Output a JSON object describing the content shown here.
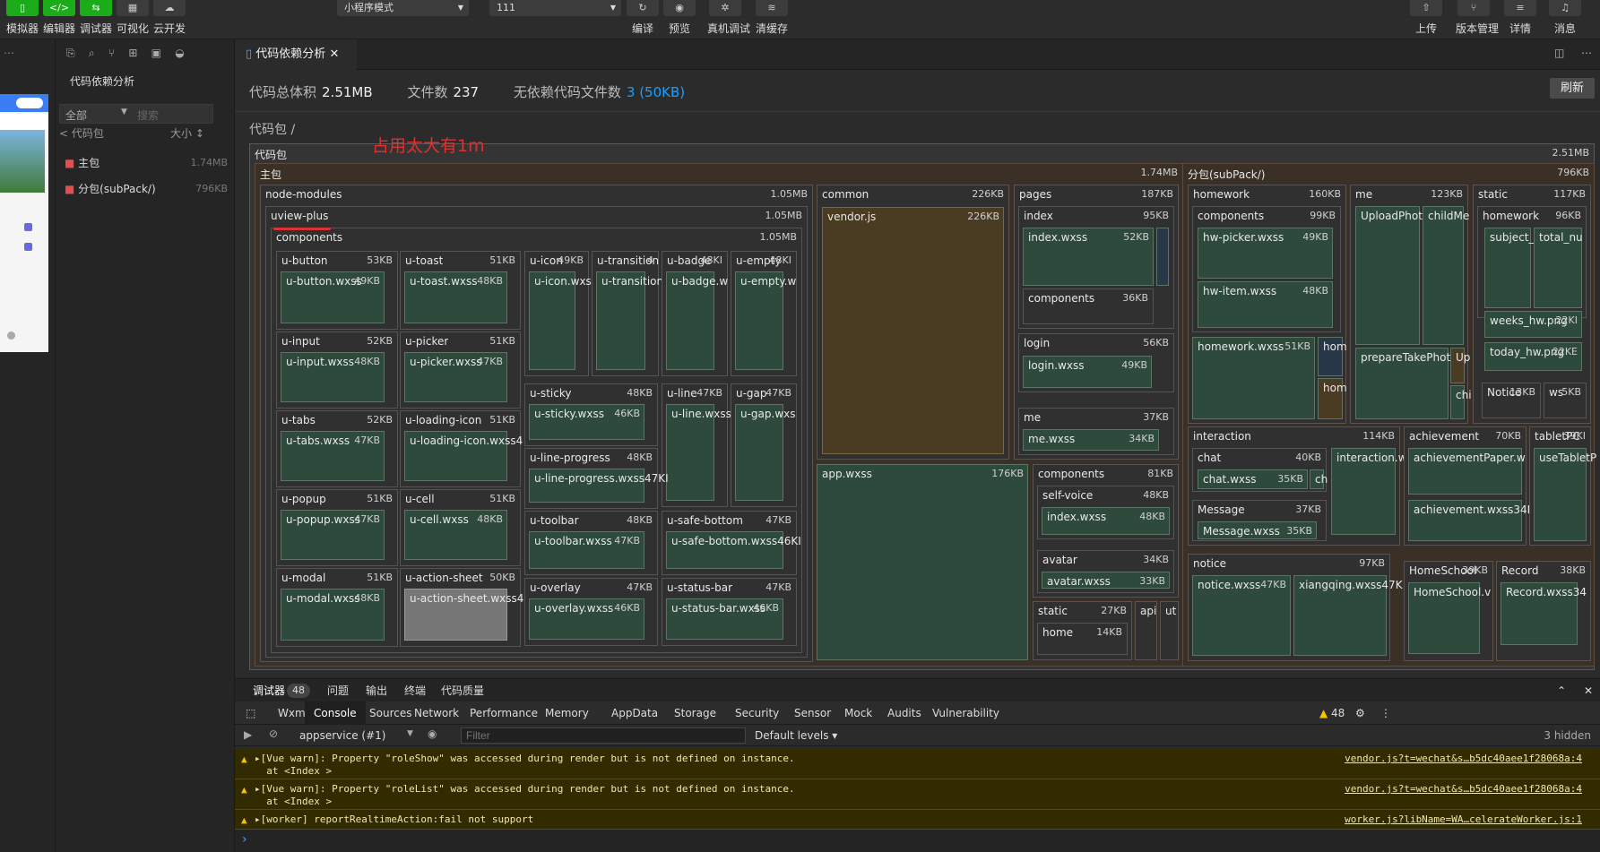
{
  "toolbar": {
    "left_buttons": [
      {
        "label": "模拟器",
        "icon": "phone-icon"
      },
      {
        "label": "编辑器",
        "icon": "code-icon"
      },
      {
        "label": "调试器",
        "icon": "debug-icon"
      },
      {
        "label": "可视化",
        "icon": "layout-icon"
      },
      {
        "label": "云开发",
        "icon": "cloud-icon"
      }
    ],
    "mode_select": "小程序模式",
    "compile_select": "111",
    "center_buttons": [
      {
        "label": "编译",
        "icon": "refresh-icon"
      },
      {
        "label": "预览",
        "icon": "eye-icon"
      },
      {
        "label": "真机调试",
        "icon": "bug-icon"
      },
      {
        "label": "清缓存",
        "icon": "layers-icon"
      }
    ],
    "right_buttons": [
      {
        "label": "上传",
        "icon": "upload-icon"
      },
      {
        "label": "版本管理",
        "icon": "branch-icon"
      },
      {
        "label": "详情",
        "icon": "menu-icon"
      },
      {
        "label": "消息",
        "icon": "bell-icon"
      }
    ]
  },
  "sidebar": {
    "title": "代码依赖分析",
    "filter": "全部",
    "search_placeholder": "搜索",
    "back": "< 代码包",
    "sort": "大小 ↕",
    "items": [
      {
        "label": "主包",
        "size": "1.74MB"
      },
      {
        "label": "分包(subPack/)",
        "size": "796KB"
      }
    ]
  },
  "tab": {
    "title": "代码依赖分析",
    "close": "✕"
  },
  "stats": {
    "total_label": "代码总体积",
    "total": "2.51MB",
    "files_label": "文件数",
    "files": "237",
    "nodep_label": "无依赖代码文件数",
    "nodep": "3 (50KB)",
    "refresh": "刷新"
  },
  "crumb": "代码包 /",
  "annotation": "占用太大有1m",
  "treemap": {
    "root": {
      "label": "代码包",
      "size": "2.51MB"
    },
    "main": {
      "label": "主包",
      "size": "1.74MB"
    },
    "subpack": {
      "label": "分包(subPack/)",
      "size": "796KB"
    },
    "node_modules": {
      "label": "node-modules",
      "size": "1.05MB"
    },
    "uview": {
      "label": "uview-plus",
      "size": "1.05MB"
    },
    "components": {
      "label": "components",
      "size": "1.05MB"
    },
    "comps": [
      {
        "label": "u-button",
        "size": "53KB",
        "file": "u-button.wxss",
        "fsize": "49KB"
      },
      {
        "label": "u-toast",
        "size": "51KB",
        "file": "u-toast.wxss",
        "fsize": "48KB"
      },
      {
        "label": "u-icon",
        "size": "49KB",
        "file": "u-icon.wxss",
        "fsize": ""
      },
      {
        "label": "u-transition",
        "size": "4",
        "file": "u-transition",
        "fsize": ""
      },
      {
        "label": "u-badge",
        "size": "48KI",
        "file": "u-badge.w",
        "fsize": ""
      },
      {
        "label": "u-empty",
        "size": "48KI",
        "file": "u-empty.w",
        "fsize": ""
      },
      {
        "label": "u-input",
        "size": "52KB",
        "file": "u-input.wxss",
        "fsize": "48KB"
      },
      {
        "label": "u-picker",
        "size": "51KB",
        "file": "u-picker.wxss",
        "fsize": "47KB"
      },
      {
        "label": "u-sticky",
        "size": "48KB",
        "file": "u-sticky.wxss",
        "fsize": "46KB"
      },
      {
        "label": "u-line",
        "size": "47KB",
        "file": "u-line.wxss",
        "fsize": ""
      },
      {
        "label": "u-gap",
        "size": "47KB",
        "file": "u-gap.wxs",
        "fsize": ""
      },
      {
        "label": "u-tabs",
        "size": "52KB",
        "file": "u-tabs.wxss",
        "fsize": "47KB"
      },
      {
        "label": "u-loading-icon",
        "size": "51KB",
        "file": "u-loading-icon.wxss4",
        "fsize": ""
      },
      {
        "label": "u-line-progress",
        "size": "48KB",
        "file": "u-line-progress.wxss47KI",
        "fsize": ""
      },
      {
        "label": "u-popup",
        "size": "51KB",
        "file": "u-popup.wxss",
        "fsize": "47KB"
      },
      {
        "label": "u-cell",
        "size": "51KB",
        "file": "u-cell.wxss",
        "fsize": "48KB"
      },
      {
        "label": "u-toolbar",
        "size": "48KB",
        "file": "u-toolbar.wxss",
        "fsize": "47KB"
      },
      {
        "label": "u-safe-bottom",
        "size": "47KB",
        "file": "u-safe-bottom.wxss46KI",
        "fsize": ""
      },
      {
        "label": "u-modal",
        "size": "51KB",
        "file": "u-modal.wxss",
        "fsize": "48KB"
      },
      {
        "label": "u-action-sheet",
        "size": "50KB",
        "file": "u-action-sheet.wxss4",
        "fsize": ""
      },
      {
        "label": "u-overlay",
        "size": "47KB",
        "file": "u-overlay.wxss",
        "fsize": "46KB"
      },
      {
        "label": "u-status-bar",
        "size": "47KB",
        "file": "u-status-bar.wxss",
        "fsize": "46KB"
      }
    ],
    "common": {
      "label": "common",
      "size": "226KB",
      "file": "vendor.js",
      "fsize": "226KB"
    },
    "app": {
      "label": "app.wxss",
      "size": "176KB"
    },
    "pages": {
      "label": "pages",
      "size": "187KB"
    },
    "index": {
      "label": "index",
      "size": "95KB",
      "file": "index.wxss",
      "fsize": "52KB",
      "sub": "components",
      "subsize": "36KB"
    },
    "login": {
      "label": "login",
      "size": "56KB",
      "file": "login.wxss",
      "fsize": "49KB"
    },
    "me": {
      "label": "me",
      "size": "37KB",
      "file": "me.wxss",
      "fsize": "34KB"
    },
    "rcomponents": {
      "label": "components",
      "size": "81KB",
      "a": "self-voice",
      "asize": "48KB",
      "afile": "index.wxss",
      "afsize": "48KB",
      "b": "avatar",
      "bsize": "34KB",
      "bfile": "avatar.wxss",
      "bfsize": "33KB"
    },
    "static": {
      "label": "static",
      "size": "27KB",
      "file": "home",
      "fsize": "14KB"
    },
    "api": {
      "label": "api"
    },
    "ut": {
      "label": "ut"
    },
    "homework": {
      "label": "homework",
      "size": "160KB",
      "c": "components",
      "csize": "99KB",
      "f1": "hw-picker.wxss",
      "f1s": "49KB",
      "f2": "hw-item.wxss",
      "f2s": "48KB",
      "f3": "homework.wxss",
      "f3s": "51KB",
      "f4": "hom",
      "f5": "hom"
    },
    "me2": {
      "label": "me",
      "size": "123KB",
      "f1": "UploadPhoto",
      "f2": "childMe",
      "f3": "prepareTakePhoto",
      "f4": "Up",
      "f5": "chi"
    },
    "static2": {
      "label": "static",
      "size": "117KB",
      "h": "homework",
      "hsize": "96KB",
      "f1": "subject_l",
      "f2": "total_nu",
      "f3": "weeks_hw.png",
      "f3s": "22KI",
      "f4": "today_hw.png",
      "f4s": "22KE",
      "f5": "Notice",
      "f5s": "13KB",
      "f6": "ws",
      "f6s": "5KB"
    },
    "interaction": {
      "label": "interaction",
      "size": "114KB",
      "chat": "chat",
      "chatsize": "40KB",
      "chatfile": "chat.wxss",
      "chatfs": "35KB",
      "chatx": "ch",
      "ifile": "interaction.w",
      "msg": "Message",
      "msgsize": "37KB",
      "msgfile": "Message.wxss",
      "msgfs": "35KB"
    },
    "achievement": {
      "label": "achievement",
      "size": "70KB",
      "f1": "achievementPaper.w",
      "f2": "achievement.wxss34I"
    },
    "tablet": {
      "label": "tabletPC",
      "size": "39KI",
      "f1": "useTabletP"
    },
    "notice": {
      "label": "notice",
      "size": "97KB",
      "f1": "notice.wxss",
      "f1s": "47KB",
      "f2": "xiangqing.wxss47K"
    },
    "homeschool": {
      "label": "HomeSchool",
      "size": "39KB",
      "f1": "HomeSchool.v"
    },
    "record": {
      "label": "Record",
      "size": "38KB",
      "f1": "Record.wxss34"
    }
  },
  "devtools": {
    "top_tabs": [
      "调试器",
      "问题",
      "输出",
      "终端",
      "代码质量"
    ],
    "badge": "48",
    "tabs": [
      "Wxml",
      "Console",
      "Sources",
      "Network",
      "Performance",
      "Memory",
      "AppData",
      "Storage",
      "Security",
      "Sensor",
      "Mock",
      "Audits",
      "Vulnerability"
    ],
    "warn_count": "48",
    "context": "appservice (#1)",
    "filter_placeholder": "Filter",
    "levels": "Default levels ▾",
    "hidden": "3 hidden",
    "messages": [
      {
        "text": "▸[Vue warn]: Property \"roleShow\" was accessed during render but is not defined on instance.\n  at <Index >",
        "src": "vendor.js?t=wechat&s…b5dc40aee1f28068a:4"
      },
      {
        "text": "▸[Vue warn]: Property \"roleList\" was accessed during render but is not defined on instance.\n  at <Index >",
        "src": "vendor.js?t=wechat&s…b5dc40aee1f28068a:4"
      },
      {
        "text": "▸[worker] reportRealtimeAction:fail not support",
        "src": "worker.js?libName=WA…celerateWorker.js:1"
      }
    ],
    "prompt": "›"
  }
}
